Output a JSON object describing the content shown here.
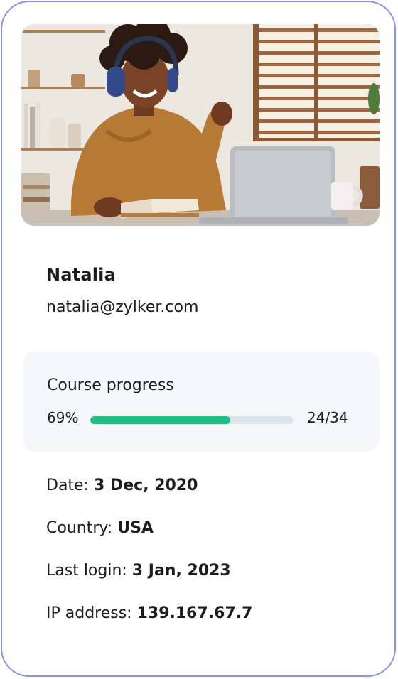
{
  "profile": {
    "name": "Natalia",
    "email": "natalia@zylker.com"
  },
  "progress": {
    "title": "Course progress",
    "percent_label": "69%",
    "percent_value": 0.69,
    "count_label": "24/34"
  },
  "details": [
    {
      "label": "Date: ",
      "value": "3 Dec, 2020"
    },
    {
      "label": "Country: ",
      "value": "USA"
    },
    {
      "label": "Last login: ",
      "value": "3 Jan, 2023"
    },
    {
      "label": "IP address: ",
      "value": "139.167.67.7"
    }
  ],
  "colors": {
    "border": "#8f8fe6",
    "progress_fill": "#22bd85",
    "progress_track": "#dbe4ea"
  }
}
